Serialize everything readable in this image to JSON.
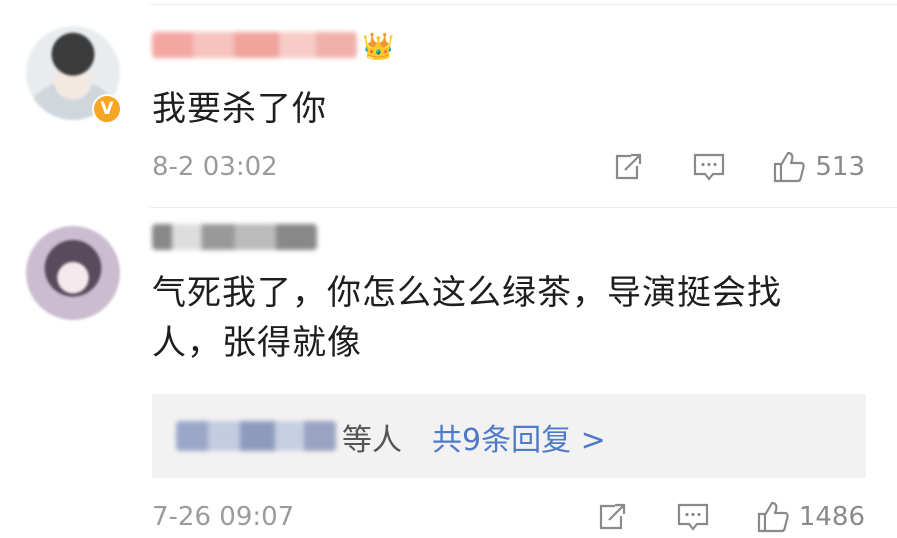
{
  "comments": [
    {
      "text": "我要杀了你",
      "timestamp": "8-2 03:02",
      "likes": "513",
      "verified": "V",
      "level_badge": "👑"
    },
    {
      "text_line1": "气死我了，你怎么这么绿茶，导演挺会找",
      "text_line2": "人，张得就像",
      "timestamp": "7-26 09:07",
      "likes": "1486",
      "reply_summary": {
        "suffix": "等人",
        "link": "共9条回复 >"
      }
    }
  ],
  "icons": {
    "repost": "repost-icon",
    "comment": "comment-icon",
    "like": "like-icon"
  },
  "colors": {
    "link": "#4f7ac7",
    "verified": "#f6a623",
    "meta": "#9b9b9b"
  }
}
